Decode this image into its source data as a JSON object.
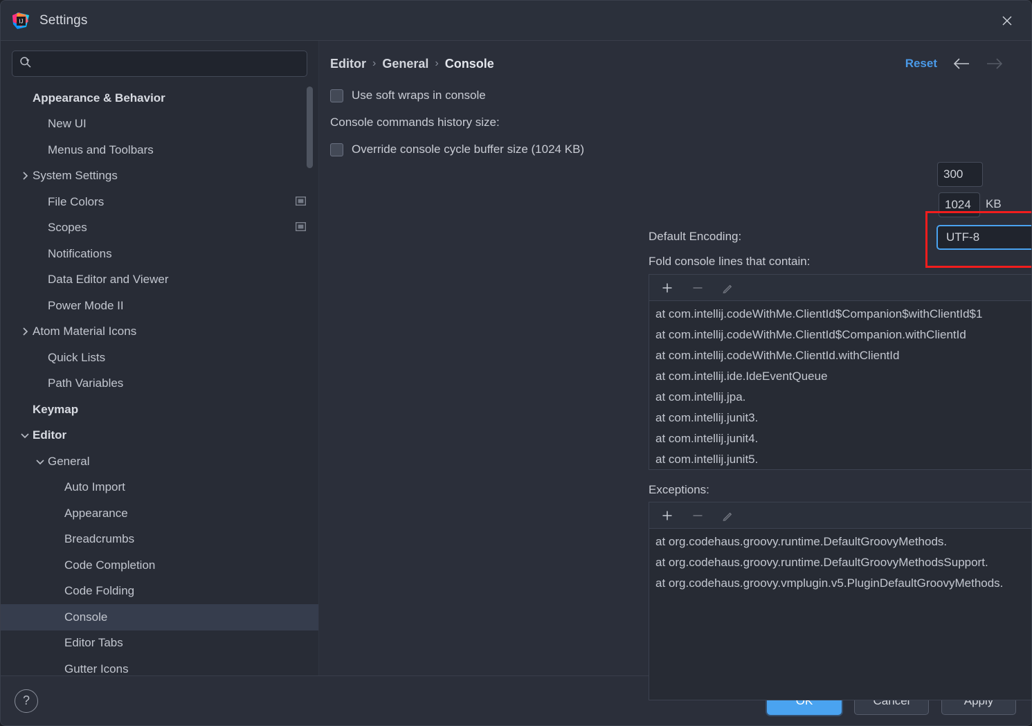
{
  "window": {
    "title": "Settings",
    "logo_icon": "intellij-idea-logo",
    "close_icon": "close-icon"
  },
  "sidebar": {
    "search": {
      "placeholder": "",
      "value": "",
      "icon": "search-icon",
      "dropdown_icon": "chevron-down-icon"
    },
    "items": [
      {
        "label": "Appearance & Behavior",
        "indent": 0,
        "bold": true,
        "twisty": "",
        "badge": "",
        "selected": false
      },
      {
        "label": "New UI",
        "indent": 1,
        "bold": false,
        "twisty": "",
        "badge": "",
        "selected": false
      },
      {
        "label": "Menus and Toolbars",
        "indent": 1,
        "bold": false,
        "twisty": "",
        "badge": "",
        "selected": false
      },
      {
        "label": "System Settings",
        "indent": 0,
        "bold": false,
        "twisty": "collapsed",
        "badge": "",
        "selected": false
      },
      {
        "label": "File Colors",
        "indent": 1,
        "bold": false,
        "twisty": "",
        "badge": "project-scope-icon",
        "selected": false
      },
      {
        "label": "Scopes",
        "indent": 1,
        "bold": false,
        "twisty": "",
        "badge": "project-scope-icon",
        "selected": false
      },
      {
        "label": "Notifications",
        "indent": 1,
        "bold": false,
        "twisty": "",
        "badge": "",
        "selected": false
      },
      {
        "label": "Data Editor and Viewer",
        "indent": 1,
        "bold": false,
        "twisty": "",
        "badge": "",
        "selected": false
      },
      {
        "label": "Power Mode II",
        "indent": 1,
        "bold": false,
        "twisty": "",
        "badge": "",
        "selected": false
      },
      {
        "label": "Atom Material Icons",
        "indent": 0,
        "bold": false,
        "twisty": "collapsed",
        "badge": "",
        "selected": false
      },
      {
        "label": "Quick Lists",
        "indent": 1,
        "bold": false,
        "twisty": "",
        "badge": "",
        "selected": false
      },
      {
        "label": "Path Variables",
        "indent": 1,
        "bold": false,
        "twisty": "",
        "badge": "",
        "selected": false
      },
      {
        "label": "Keymap",
        "indent": 0,
        "bold": true,
        "twisty": "",
        "badge": "",
        "selected": false
      },
      {
        "label": "Editor",
        "indent": 0,
        "bold": true,
        "twisty": "expanded",
        "badge": "",
        "selected": false
      },
      {
        "label": "General",
        "indent": 1,
        "bold": false,
        "twisty": "expanded",
        "badge": "",
        "selected": false
      },
      {
        "label": "Auto Import",
        "indent": 2,
        "bold": false,
        "twisty": "",
        "badge": "",
        "selected": false
      },
      {
        "label": "Appearance",
        "indent": 2,
        "bold": false,
        "twisty": "",
        "badge": "",
        "selected": false
      },
      {
        "label": "Breadcrumbs",
        "indent": 2,
        "bold": false,
        "twisty": "",
        "badge": "",
        "selected": false
      },
      {
        "label": "Code Completion",
        "indent": 2,
        "bold": false,
        "twisty": "",
        "badge": "",
        "selected": false
      },
      {
        "label": "Code Folding",
        "indent": 2,
        "bold": false,
        "twisty": "",
        "badge": "",
        "selected": false
      },
      {
        "label": "Console",
        "indent": 2,
        "bold": false,
        "twisty": "",
        "badge": "",
        "selected": true
      },
      {
        "label": "Editor Tabs",
        "indent": 2,
        "bold": false,
        "twisty": "",
        "badge": "",
        "selected": false
      },
      {
        "label": "Gutter Icons",
        "indent": 2,
        "bold": false,
        "twisty": "",
        "badge": "",
        "selected": false
      }
    ]
  },
  "header": {
    "breadcrumb": [
      "Editor",
      "General",
      "Console"
    ],
    "separator": "›",
    "reset_label": "Reset",
    "back_icon": "arrow-left-icon",
    "forward_icon": "arrow-right-icon"
  },
  "main": {
    "soft_wraps": {
      "label": "Use soft wraps in console",
      "checked": false
    },
    "history": {
      "label": "Console commands history size:",
      "value": "300"
    },
    "buffer": {
      "label": "Override console cycle buffer size (1024 KB)",
      "checked": false,
      "value": "1024",
      "unit": "KB"
    },
    "encoding": {
      "label": "Default Encoding:",
      "value": "UTF-8",
      "chevron_icon": "chevron-down-icon",
      "highlighted": true,
      "highlight_color": "#f21d1d",
      "focus_color": "#4aa3f0"
    },
    "fold": {
      "label": "Fold console lines that contain:",
      "toolbar": {
        "add_icon": "plus-icon",
        "remove_icon": "minus-icon",
        "edit_icon": "pencil-icon"
      },
      "items": [
        "at com.intellij.codeWithMe.ClientId$Companion$withClientId$1",
        "at com.intellij.codeWithMe.ClientId$Companion.withClientId",
        "at com.intellij.codeWithMe.ClientId.withClientId",
        "at com.intellij.ide.IdeEventQueue",
        "at com.intellij.jpa.",
        "at com.intellij.junit3.",
        "at com.intellij.junit4.",
        "at com.intellij.junit5."
      ]
    },
    "exceptions": {
      "label": "Exceptions:",
      "toolbar": {
        "add_icon": "plus-icon",
        "remove_icon": "minus-icon",
        "edit_icon": "pencil-icon"
      },
      "items": [
        "at org.codehaus.groovy.runtime.DefaultGroovyMethods.",
        "at org.codehaus.groovy.runtime.DefaultGroovyMethodsSupport.",
        "at org.codehaus.groovy.vmplugin.v5.PluginDefaultGroovyMethods."
      ]
    }
  },
  "footer": {
    "help_icon": "question-mark-icon",
    "help_label": "?",
    "ok_label": "OK",
    "cancel_label": "Cancel",
    "apply_label": "Apply"
  }
}
